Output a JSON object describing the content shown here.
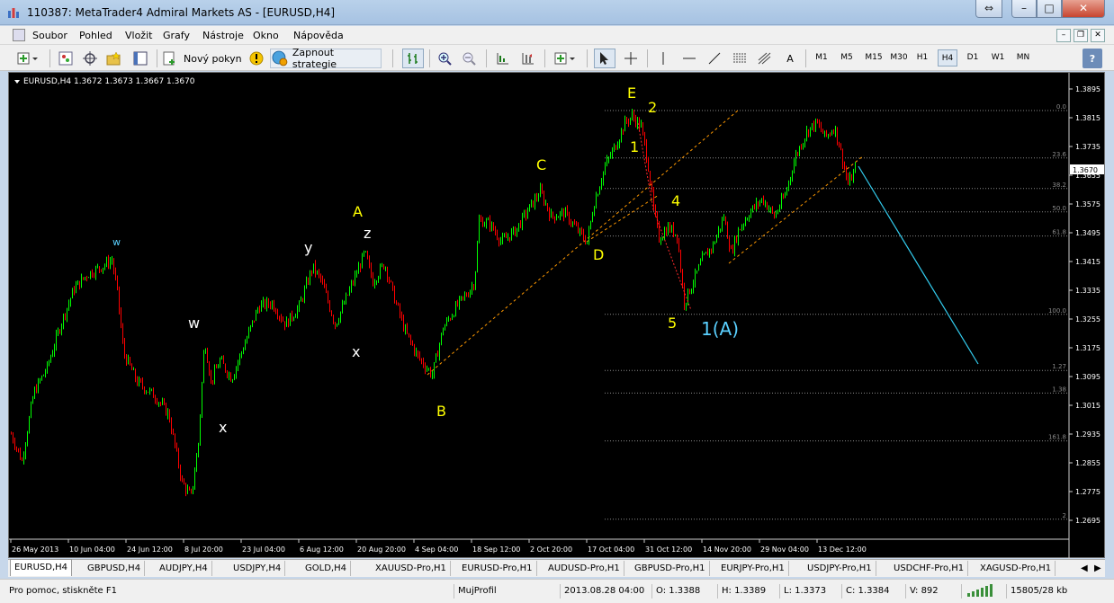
{
  "window": {
    "title": "110387: MetaTrader4 Admiral Markets AS - [EURUSD,H4]",
    "restore_glyph": "⇔",
    "minimize_glyph": "–",
    "maximize_glyph": "□",
    "close_glyph": "✕"
  },
  "menu": {
    "items": [
      "Soubor",
      "Pohled",
      "Vložit",
      "Grafy",
      "Nástroje",
      "Okno",
      "Nápověda"
    ],
    "mdi_minimize": "–",
    "mdi_restore": "❐",
    "mdi_close": "✕"
  },
  "toolbar": {
    "new_order": "Nový pokyn",
    "autotrading": "Zapnout strategie",
    "text_tool": "A",
    "timeframes": [
      "M1",
      "M5",
      "M15",
      "M30",
      "H1",
      "H4",
      "D1",
      "W1",
      "MN"
    ],
    "active_timeframe": "H4",
    "help_glyph": "?"
  },
  "chart": {
    "header": "EURUSD,H4  1.3672 1.3673 1.3667 1.3670",
    "current_price": "1.3670",
    "colors": {
      "background": "#000000",
      "bull": "#00ff00",
      "bear": "#ff0000",
      "wave_yellow": "#ffff00",
      "wave_white": "#ffffff",
      "wave_cyan": "#5ad0ff",
      "channel": "#ff9900",
      "projection": "#33ccee"
    }
  },
  "chart_data": {
    "type": "candlestick",
    "symbol": "EURUSD",
    "timeframe": "H4",
    "ylim": [
      1.2655,
      1.3935
    ],
    "price_ticks": [
      "1.3895",
      "1.3815",
      "1.3735",
      "1.3655",
      "1.3575",
      "1.3495",
      "1.3415",
      "1.3335",
      "1.3255",
      "1.3175",
      "1.3095",
      "1.3015",
      "1.2935",
      "1.2855",
      "1.2775",
      "1.2695"
    ],
    "date_labels": [
      "26 May 2013",
      "10 Jun 04:00",
      "24 Jun 12:00",
      "8 Jul 20:00",
      "23 Jul 04:00",
      "6 Aug 12:00",
      "20 Aug 20:00",
      "4 Sep 04:00",
      "18 Sep 12:00",
      "2 Oct 20:00",
      "17 Oct 04:00",
      "31 Oct 12:00",
      "14 Nov 20:00",
      "29 Nov 04:00",
      "13 Dec 12:00"
    ],
    "price_path": [
      {
        "x": 0,
        "price": 1.2935
      },
      {
        "x": 12,
        "price": 1.286
      },
      {
        "x": 25,
        "price": 1.305
      },
      {
        "x": 40,
        "price": 1.312
      },
      {
        "x": 55,
        "price": 1.324
      },
      {
        "x": 70,
        "price": 1.334
      },
      {
        "x": 85,
        "price": 1.338
      },
      {
        "x": 100,
        "price": 1.34
      },
      {
        "x": 112,
        "price": 1.342
      },
      {
        "x": 118,
        "price": 1.333
      },
      {
        "x": 125,
        "price": 1.316
      },
      {
        "x": 140,
        "price": 1.308
      },
      {
        "x": 160,
        "price": 1.304
      },
      {
        "x": 175,
        "price": 1.299
      },
      {
        "x": 190,
        "price": 1.28
      },
      {
        "x": 200,
        "price": 1.276
      },
      {
        "x": 208,
        "price": 1.291
      },
      {
        "x": 215,
        "price": 1.32
      },
      {
        "x": 222,
        "price": 1.308
      },
      {
        "x": 232,
        "price": 1.314
      },
      {
        "x": 245,
        "price": 1.309
      },
      {
        "x": 260,
        "price": 1.319
      },
      {
        "x": 275,
        "price": 1.329
      },
      {
        "x": 290,
        "price": 1.33
      },
      {
        "x": 305,
        "price": 1.324
      },
      {
        "x": 320,
        "price": 1.329
      },
      {
        "x": 335,
        "price": 1.34
      },
      {
        "x": 345,
        "price": 1.336
      },
      {
        "x": 360,
        "price": 1.324
      },
      {
        "x": 372,
        "price": 1.331
      },
      {
        "x": 385,
        "price": 1.339
      },
      {
        "x": 393,
        "price": 1.344
      },
      {
        "x": 402,
        "price": 1.336
      },
      {
        "x": 415,
        "price": 1.341
      },
      {
        "x": 425,
        "price": 1.332
      },
      {
        "x": 438,
        "price": 1.322
      },
      {
        "x": 452,
        "price": 1.315
      },
      {
        "x": 468,
        "price": 1.31
      },
      {
        "x": 480,
        "price": 1.323
      },
      {
        "x": 495,
        "price": 1.329
      },
      {
        "x": 508,
        "price": 1.333
      },
      {
        "x": 515,
        "price": 1.336
      },
      {
        "x": 520,
        "price": 1.353
      },
      {
        "x": 532,
        "price": 1.352
      },
      {
        "x": 545,
        "price": 1.347
      },
      {
        "x": 560,
        "price": 1.35
      },
      {
        "x": 575,
        "price": 1.356
      },
      {
        "x": 588,
        "price": 1.361
      },
      {
        "x": 600,
        "price": 1.354
      },
      {
        "x": 615,
        "price": 1.355
      },
      {
        "x": 630,
        "price": 1.35
      },
      {
        "x": 640,
        "price": 1.347
      },
      {
        "x": 648,
        "price": 1.358
      },
      {
        "x": 660,
        "price": 1.368
      },
      {
        "x": 672,
        "price": 1.374
      },
      {
        "x": 682,
        "price": 1.38
      },
      {
        "x": 690,
        "price": 1.382
      },
      {
        "x": 700,
        "price": 1.379
      },
      {
        "x": 707,
        "price": 1.37
      },
      {
        "x": 714,
        "price": 1.356
      },
      {
        "x": 720,
        "price": 1.348
      },
      {
        "x": 730,
        "price": 1.351
      },
      {
        "x": 740,
        "price": 1.349
      },
      {
        "x": 748,
        "price": 1.33
      },
      {
        "x": 758,
        "price": 1.336
      },
      {
        "x": 768,
        "price": 1.342
      },
      {
        "x": 780,
        "price": 1.346
      },
      {
        "x": 792,
        "price": 1.354
      },
      {
        "x": 800,
        "price": 1.344
      },
      {
        "x": 808,
        "price": 1.35
      },
      {
        "x": 820,
        "price": 1.355
      },
      {
        "x": 835,
        "price": 1.359
      },
      {
        "x": 848,
        "price": 1.354
      },
      {
        "x": 860,
        "price": 1.36
      },
      {
        "x": 872,
        "price": 1.371
      },
      {
        "x": 885,
        "price": 1.378
      },
      {
        "x": 895,
        "price": 1.38
      },
      {
        "x": 905,
        "price": 1.376
      },
      {
        "x": 915,
        "price": 1.379
      },
      {
        "x": 922,
        "price": 1.372
      },
      {
        "x": 930,
        "price": 1.363
      },
      {
        "x": 938,
        "price": 1.367
      }
    ],
    "fib_levels": [
      {
        "label": "0.0",
        "price": 1.3835
      },
      {
        "label": "23.6",
        "price": 1.3703
      },
      {
        "label": "38.2",
        "price": 1.3618
      },
      {
        "label": "50.0",
        "price": 1.3553
      },
      {
        "label": "61.8",
        "price": 1.3486
      },
      {
        "label": "100.0",
        "price": 1.3268
      },
      {
        "label": "1.27",
        "price": 1.3112
      },
      {
        "label": "1.38",
        "price": 1.3049
      },
      {
        "label": "161.8",
        "price": 1.2916
      },
      {
        "label": "2",
        "price": 1.2698
      }
    ],
    "wave_labels": [
      {
        "text": "w",
        "color": "cyan",
        "x": 113,
        "price": 1.346
      },
      {
        "text": "w",
        "color": "white",
        "x": 197,
        "price": 1.323
      },
      {
        "text": "x",
        "color": "white",
        "x": 231,
        "price": 1.294
      },
      {
        "text": "y",
        "color": "white",
        "x": 326,
        "price": 1.344
      },
      {
        "text": "A",
        "color": "yellow",
        "x": 380,
        "price": 1.354
      },
      {
        "text": "z",
        "color": "white",
        "x": 392,
        "price": 1.348
      },
      {
        "text": "x",
        "color": "white",
        "x": 379,
        "price": 1.315
      },
      {
        "text": "B",
        "color": "yellow",
        "x": 473,
        "price": 1.2985
      },
      {
        "text": "C",
        "color": "yellow",
        "x": 584,
        "price": 1.367
      },
      {
        "text": "D",
        "color": "yellow",
        "x": 647,
        "price": 1.342
      },
      {
        "text": "E",
        "color": "yellow",
        "x": 685,
        "price": 1.387
      },
      {
        "text": "2",
        "color": "yellow",
        "x": 708,
        "price": 1.383
      },
      {
        "text": "1",
        "color": "yellow",
        "x": 688,
        "price": 1.372
      },
      {
        "text": "4",
        "color": "yellow",
        "x": 734,
        "price": 1.357
      },
      {
        "text": "5",
        "color": "yellow",
        "x": 730,
        "price": 1.323
      },
      {
        "text": "1(A)",
        "color": "cyan",
        "x": 767,
        "price": 1.321
      }
    ],
    "channels": [
      {
        "from": {
          "x": 463,
          "price": 1.31
        },
        "to": {
          "x": 808,
          "price": 1.3835
        }
      },
      {
        "from": {
          "x": 640,
          "price": 1.347
        },
        "to": {
          "x": 720,
          "price": 1.36
        }
      },
      {
        "from": {
          "x": 798,
          "price": 1.341
        },
        "to": {
          "x": 948,
          "price": 1.371
        }
      }
    ],
    "projection": {
      "from": {
        "x": 942,
        "price": 1.368
      },
      "to": {
        "x": 1075,
        "price": 1.313
      }
    },
    "wave_lines": [
      {
        "from": {
          "x": 697,
          "price": 1.38
        },
        "to": {
          "x": 714,
          "price": 1.356
        }
      },
      {
        "from": {
          "x": 714,
          "price": 1.356
        },
        "to": {
          "x": 756,
          "price": 1.328
        }
      }
    ]
  },
  "symbol_tabs": [
    "EURUSD,H4",
    "GBPUSD,H4",
    "AUDJPY,H4",
    "USDJPY,H4",
    "GOLD,H4",
    "XAUUSD-Pro,H1",
    "EURUSD-Pro,H1",
    "AUDUSD-Pro,H1",
    "GBPUSD-Pro,H1",
    "EURJPY-Pro,H1",
    "USDJPY-Pro,H1",
    "USDCHF-Pro,H1",
    "XAGUSD-Pro,H1"
  ],
  "status": {
    "help": "Pro pomoc, stiskněte F1",
    "profile": "MujProfil",
    "time": "2013.08.28 04:00",
    "open": "O: 1.3388",
    "high": "H: 1.3389",
    "low": "L: 1.3373",
    "close": "C: 1.3384",
    "volume": "V: 892",
    "traffic": "15805/28 kb"
  }
}
